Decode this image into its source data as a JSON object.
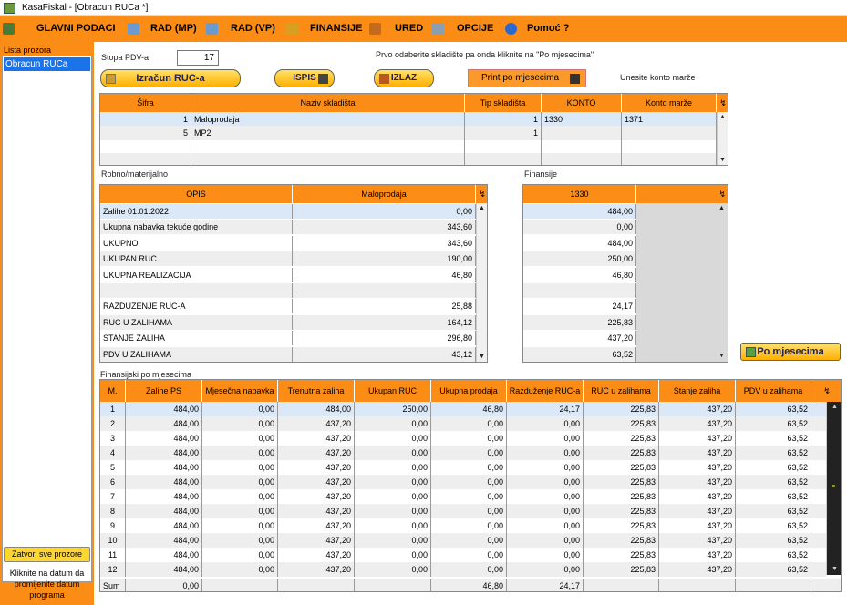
{
  "window": {
    "title": "KasaFiskal  - [Obracun RUCa *]"
  },
  "menu": [
    {
      "label": "GLAVNI PODACI"
    },
    {
      "label": "RAD (MP)"
    },
    {
      "label": "RAD (VP)"
    },
    {
      "label": "FINANSIJE"
    },
    {
      "label": "URED"
    },
    {
      "label": "OPCIJE"
    },
    {
      "label": "Pomoć ?"
    }
  ],
  "sidebar": {
    "title": "Lista prozora",
    "items": [
      "Obracun RUCa"
    ],
    "close_all": "Zatvori sve prozore",
    "hint": "Kliknite na datum da promijenite datum programa"
  },
  "form": {
    "stopa_label": "Stopa PDV-a",
    "stopa_value": "17",
    "instruction": "Prvo odaberite skladište pa onda kliknite na \"Po mjesecima\"",
    "izracun": "Izračun RUC-a",
    "ispis": "ISPIS",
    "izlaz": "IZLAZ",
    "print": "Print po mjesecima",
    "konto_hint": "Unesite konto marže",
    "po_mjesecima": "Po mjesecima"
  },
  "warehouses": {
    "headers": [
      "Šifra",
      "Naziv skladišta",
      "Tip skladišta",
      "KONTO",
      "Konto marže"
    ],
    "rows": [
      [
        "1",
        "Maloprodaja",
        "1",
        "1330",
        "1371"
      ],
      [
        "5",
        "MP2",
        "1",
        "",
        ""
      ],
      [
        "",
        "",
        "",
        "",
        ""
      ],
      [
        "",
        "",
        "",
        "",
        ""
      ]
    ]
  },
  "robno": {
    "title": "Robno/materijalno",
    "headers": [
      "OPIS",
      "Maloprodaja"
    ],
    "rows": [
      [
        "Zalihe 01.01.2022",
        "0,00"
      ],
      [
        "Ukupna nabavka tekuće godine",
        "343,60"
      ],
      [
        "UKUPNO",
        "343,60"
      ],
      [
        "UKUPAN RUC",
        "190,00"
      ],
      [
        "UKUPNA REALIZACIJA",
        "46,80"
      ],
      [
        "",
        ""
      ],
      [
        "RAZDUŽENJE RUC-A",
        "25,88"
      ],
      [
        "RUC U ZALIHAMA",
        "164,12"
      ],
      [
        "STANJE ZALIHA",
        "296,80"
      ],
      [
        "PDV U ZALIHAMA",
        "43,12"
      ]
    ]
  },
  "finansije": {
    "title": "Finansije",
    "headers": [
      "1330"
    ],
    "rows": [
      "484,00",
      "0,00",
      "484,00",
      "250,00",
      "46,80",
      "",
      "24,17",
      "225,83",
      "437,20",
      "63,52"
    ]
  },
  "monthly": {
    "title": "Finansijski po mjesecima",
    "headers": [
      "M.",
      "Zalihe PS",
      "Mjesečna nabavka",
      "Trenutna zaliha",
      "Ukupan RUC",
      "Ukupna prodaja",
      "Razduženje RUC-a",
      "RUC u zalihama",
      "Stanje zaliha",
      "PDV u zalihama"
    ],
    "rows": [
      [
        "1",
        "484,00",
        "0,00",
        "484,00",
        "250,00",
        "46,80",
        "24,17",
        "225,83",
        "437,20",
        "63,52"
      ],
      [
        "2",
        "484,00",
        "0,00",
        "437,20",
        "0,00",
        "0,00",
        "0,00",
        "225,83",
        "437,20",
        "63,52"
      ],
      [
        "3",
        "484,00",
        "0,00",
        "437,20",
        "0,00",
        "0,00",
        "0,00",
        "225,83",
        "437,20",
        "63,52"
      ],
      [
        "4",
        "484,00",
        "0,00",
        "437,20",
        "0,00",
        "0,00",
        "0,00",
        "225,83",
        "437,20",
        "63,52"
      ],
      [
        "5",
        "484,00",
        "0,00",
        "437,20",
        "0,00",
        "0,00",
        "0,00",
        "225,83",
        "437,20",
        "63,52"
      ],
      [
        "6",
        "484,00",
        "0,00",
        "437,20",
        "0,00",
        "0,00",
        "0,00",
        "225,83",
        "437,20",
        "63,52"
      ],
      [
        "7",
        "484,00",
        "0,00",
        "437,20",
        "0,00",
        "0,00",
        "0,00",
        "225,83",
        "437,20",
        "63,52"
      ],
      [
        "8",
        "484,00",
        "0,00",
        "437,20",
        "0,00",
        "0,00",
        "0,00",
        "225,83",
        "437,20",
        "63,52"
      ],
      [
        "9",
        "484,00",
        "0,00",
        "437,20",
        "0,00",
        "0,00",
        "0,00",
        "225,83",
        "437,20",
        "63,52"
      ],
      [
        "10",
        "484,00",
        "0,00",
        "437,20",
        "0,00",
        "0,00",
        "0,00",
        "225,83",
        "437,20",
        "63,52"
      ],
      [
        "11",
        "484,00",
        "0,00",
        "437,20",
        "0,00",
        "0,00",
        "0,00",
        "225,83",
        "437,20",
        "63,52"
      ],
      [
        "12",
        "484,00",
        "0,00",
        "437,20",
        "0,00",
        "0,00",
        "0,00",
        "225,83",
        "437,20",
        "63,52"
      ]
    ],
    "sum": [
      "Sum",
      "0,00",
      "",
      "",
      "",
      "46,80",
      "24,17",
      "",
      "",
      ""
    ]
  }
}
